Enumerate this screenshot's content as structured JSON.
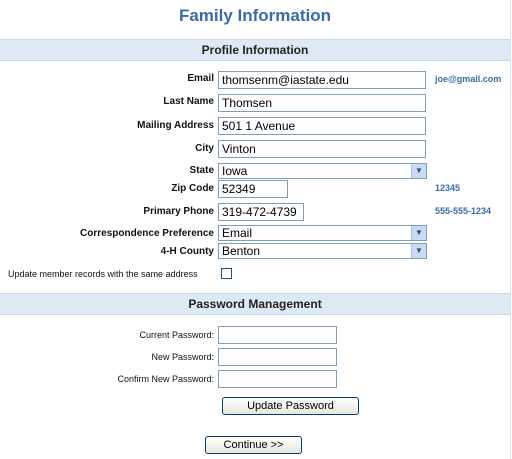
{
  "page": {
    "title": "Family Information"
  },
  "profile": {
    "section_title": "Profile Information",
    "email_label": "Email",
    "email_value": "thomsenm@iastate.edu",
    "email_hint": "joe@gmail.com",
    "last_name_label": "Last Name",
    "last_name_value": "Thomsen",
    "mailing_address_label": "Mailing Address",
    "mailing_address_value": "501 1 Avenue",
    "city_label": "City",
    "city_value": "Vinton",
    "state_label": "State",
    "state_value": "Iowa",
    "zip_label": "Zip Code",
    "zip_value": "52349",
    "zip_hint": "12345",
    "phone_label": "Primary Phone",
    "phone_value": "319-472-4739",
    "phone_hint": "555-555-1234",
    "correspondence_label": "Correspondence Preference",
    "correspondence_value": "Email",
    "county_label": "4-H County",
    "county_value": "Benton",
    "update_records_label": "Update member records with the same address"
  },
  "password": {
    "section_title": "Password Management",
    "current_label": "Current Password:",
    "new_label": "New Password:",
    "confirm_label": "Confirm New Password:",
    "update_button": "Update Password"
  },
  "footer": {
    "continue_button": "Continue >>"
  },
  "colors": {
    "accent": "#3a6aa8",
    "band": "#dfe9f5"
  },
  "icons": {
    "dropdown": "chevron-down-icon"
  }
}
